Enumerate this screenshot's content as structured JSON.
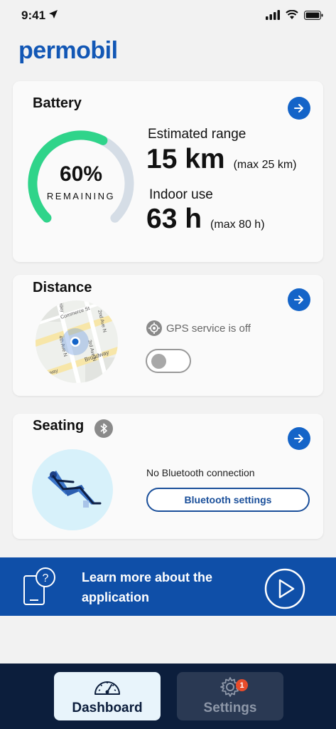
{
  "status": {
    "time": "9:41"
  },
  "brand": {
    "logo_text": "permobil",
    "accent": "#1464c8"
  },
  "battery": {
    "title": "Battery",
    "percent": 60,
    "percent_text": "60%",
    "remaining_label": "REMAINING",
    "estimated_range_label": "Estimated range",
    "range_value": "15 km",
    "range_max": "(max 25 km)",
    "indoor_label": "Indoor use",
    "indoor_value": "63 h",
    "indoor_max": "(max 80 h)",
    "gauge_color": "#2fd48a"
  },
  "distance": {
    "title": "Distance",
    "gps_status": "GPS service is off",
    "gps_toggle_on": false,
    "map_labels": [
      "Commerce St",
      "2nd Ave N",
      "4th Ave N",
      "Broadway",
      "3rd Ave N",
      "way",
      "Alley"
    ]
  },
  "seating": {
    "title": "Seating",
    "status": "No Bluetooth connection",
    "bluetooth_button": "Bluetooth settings"
  },
  "banner": {
    "text": "Learn more about the application"
  },
  "nav": {
    "dashboard": "Dashboard",
    "settings": "Settings",
    "settings_badge": "1"
  }
}
